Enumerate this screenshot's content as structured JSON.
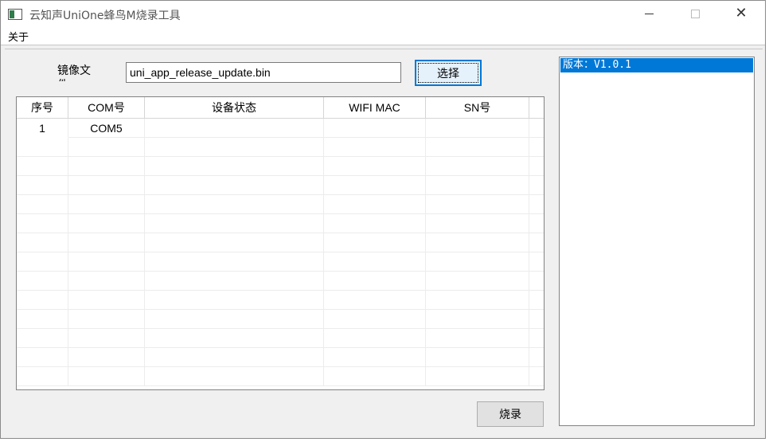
{
  "window": {
    "title": "云知声UniOne蜂鸟M烧录工具",
    "controls": {
      "minimize": "minimize",
      "maximize": "maximize",
      "close": "✕"
    }
  },
  "menu": {
    "items": [
      "关于"
    ]
  },
  "image_file": {
    "label": "镜像文件",
    "value": "uni_app_release_update.bin",
    "select_button": "选择"
  },
  "table": {
    "columns": [
      "序号",
      "COM号",
      "设备状态",
      "WIFI MAC",
      "SN号"
    ],
    "rows": [
      [
        "1",
        "COM5",
        "",
        "",
        ""
      ]
    ]
  },
  "burn_button": "烧录",
  "log": {
    "lines": [
      "版本：V1.0.1"
    ]
  },
  "colors": {
    "accent": "#0078d7",
    "window_bg": "#f0f0f0"
  },
  "icons": {
    "app": "app-window-icon"
  }
}
